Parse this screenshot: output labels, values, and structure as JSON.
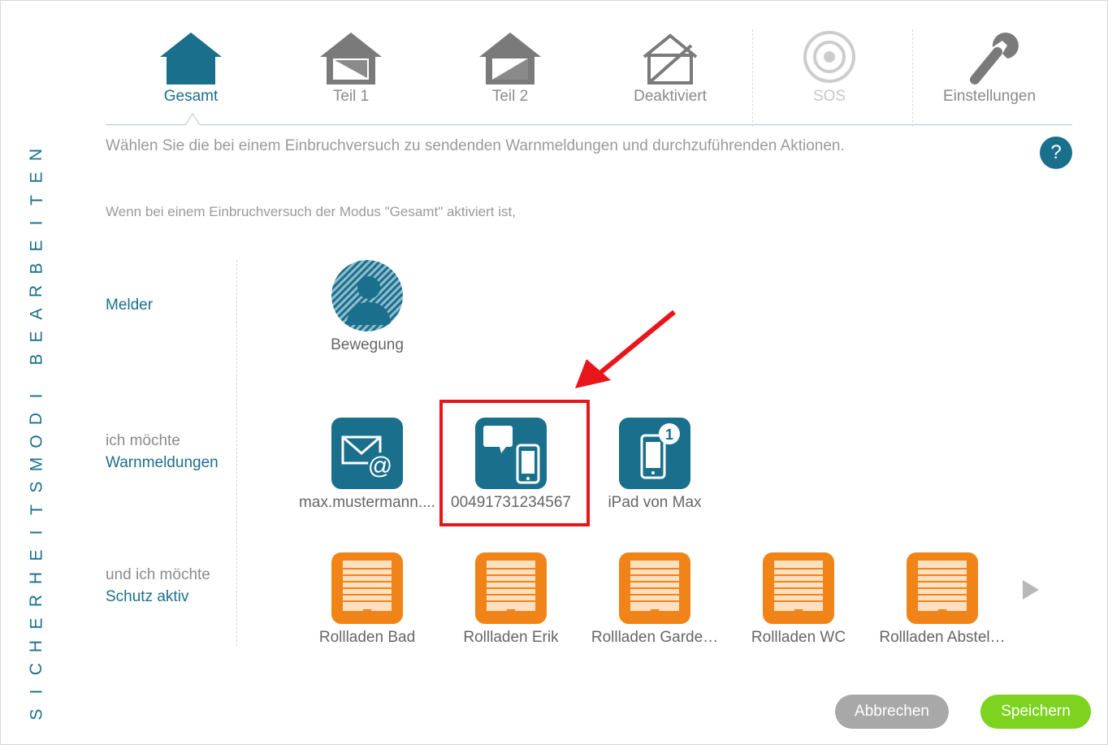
{
  "vertical_title": [
    "S",
    "I",
    "C",
    "H",
    "E",
    "R",
    "H",
    "E",
    "I",
    "T",
    "S",
    "M",
    "O",
    "D",
    "I",
    " ",
    "B",
    "E",
    "A",
    "R",
    "B",
    "E",
    "I",
    "T",
    "E",
    "N"
  ],
  "modes": [
    {
      "label": "Gesamt",
      "icon": "house-filled-icon",
      "state": "active"
    },
    {
      "label": "Teil 1",
      "icon": "house-partial-icon",
      "state": "normal"
    },
    {
      "label": "Teil 2",
      "icon": "house-partial-icon",
      "state": "normal"
    },
    {
      "label": "Deaktiviert",
      "icon": "house-outline-icon",
      "state": "normal"
    },
    {
      "label": "SOS",
      "icon": "target-icon",
      "state": "disabled"
    },
    {
      "label": "Einstellungen",
      "icon": "wrench-icon",
      "state": "normal"
    }
  ],
  "intro_text": "Wählen Sie die bei einem Einbruchversuch zu sendenden Warnmeldungen und durchzuführenden Aktionen.",
  "help_label": "?",
  "condition_text": "Wenn bei einem Einbruchversuch der Modus \"Gesamt\" aktiviert ist,",
  "rows": {
    "melder": {
      "label": "Melder"
    },
    "warn": {
      "label_muted": "ich möchte",
      "label_accent": "Warnmeldungen"
    },
    "schutz": {
      "label_muted": "und ich möchte",
      "label_accent": "Schutz aktiv"
    }
  },
  "melder_items": [
    {
      "name": "Bewegung",
      "icon": "motion-sensor-icon"
    }
  ],
  "warn_items": [
    {
      "name": "max.mustermann....",
      "icon": "email-icon"
    },
    {
      "name": "00491731234567",
      "icon": "sms-phone-icon"
    },
    {
      "name": "iPad von Max",
      "icon": "push-phone-icon",
      "badge": "1"
    }
  ],
  "schutz_items": [
    {
      "name": "Rollladen Bad",
      "icon": "shutter-icon"
    },
    {
      "name": "Rollladen Erik",
      "icon": "shutter-icon"
    },
    {
      "name": "Rollladen Garde…",
      "icon": "shutter-icon"
    },
    {
      "name": "Rollladen WC",
      "icon": "shutter-icon"
    },
    {
      "name": "Rollladen Abstel…",
      "icon": "shutter-icon"
    }
  ],
  "buttons": {
    "cancel": "Abbrechen",
    "save": "Speichern"
  },
  "colors": {
    "accent": "#1a6f8c",
    "orange": "#f08418",
    "save_green": "#7ed321",
    "cancel_gray": "#a8a8a8",
    "highlight_red": "#e8151b"
  }
}
